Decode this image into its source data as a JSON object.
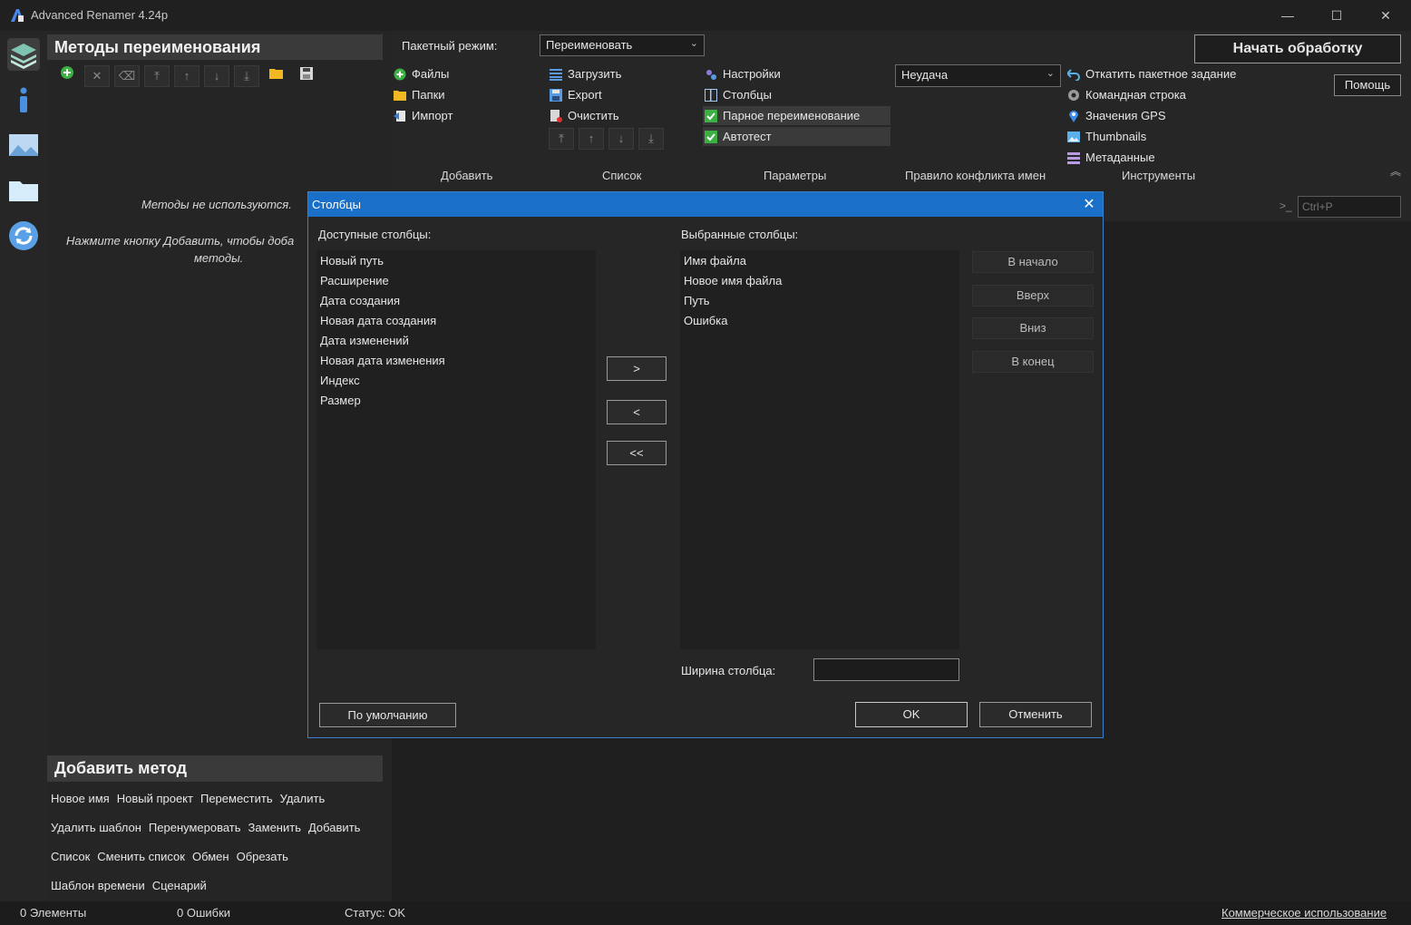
{
  "window": {
    "title": "Advanced Renamer 4.24p",
    "controls": [
      "—",
      "☐",
      "✕"
    ]
  },
  "left_nav": {
    "items": [
      "layers-icon",
      "info-icon",
      "image-icon",
      "folder-icon",
      "refresh-icon"
    ]
  },
  "methods_panel": {
    "title": "Методы переименования",
    "empty_text": "Методы не используются.",
    "hint_line1": "Нажмите кнопку Добавить, чтобы доба",
    "hint_line2": "методы.",
    "toolbar": [
      "+",
      "✕",
      "⌫",
      "⤒",
      "↑",
      "↓",
      "⤓",
      "📁",
      "💾"
    ]
  },
  "add_method": {
    "title": "Добавить метод",
    "rows": [
      [
        "Новое имя",
        "Новый проект",
        "Переместить",
        "Удалить"
      ],
      [
        "Удалить шаблон",
        "Перенумеровать",
        "Заменить",
        "Добавить"
      ],
      [
        "Список",
        "Сменить список",
        "Обмен",
        "Обрезать"
      ],
      [
        "Шаблон времени",
        "Сценарий"
      ]
    ]
  },
  "ribbon": {
    "batch_mode_label": "Пакетный режим:",
    "batch_mode_value": "Переименовать",
    "start_button": "Начать обработку",
    "help_button": "Помощь",
    "add_group": {
      "files": "Файлы",
      "folders": "Папки",
      "import": "Импорт",
      "tab": "Добавить"
    },
    "list_group": {
      "load": "Загрузить",
      "export": "Export",
      "clear": "Очистить",
      "tab": "Список"
    },
    "params_group": {
      "settings": "Настройки",
      "columns": "Столбцы",
      "pair_rename": "Парное переименование",
      "autotest": "Автотест",
      "tab": "Параметры"
    },
    "conflict_group": {
      "value": "Неудача",
      "tab": "Правило конфликта имен"
    },
    "tools_group": {
      "undo_batch": "Откатить пакетное задание",
      "command_line": "Командная строка",
      "gps": "Значения GPS",
      "thumbnails": "Thumbnails",
      "metadata": "Метаданные",
      "tab": "Инструменты"
    },
    "search_placeholder": "Ctrl+P"
  },
  "dialog": {
    "title": "Столбцы",
    "available_label": "Доступные столбцы:",
    "available": [
      "Новый путь",
      "Расширение",
      "Дата создания",
      "Новая дата создания",
      "Дата изменений",
      "Новая дата изменения",
      "Индекс",
      "Размер"
    ],
    "selected_label": "Выбранные столбцы:",
    "selected": [
      "Имя файла",
      "Новое имя файла",
      "Путь",
      "Ошибка"
    ],
    "move_add": ">",
    "move_remove": "<",
    "move_remove_all": "<<",
    "to_start": "В начало",
    "up": "Вверх",
    "down": "Вниз",
    "to_end": "В конец",
    "width_label": "Ширина столбца:",
    "width_value": "",
    "default_button": "По умолчанию",
    "ok_button": "OK",
    "cancel_button": "Отменить"
  },
  "status": {
    "items": "0 Элементы",
    "errors": "0 Ошибки",
    "status": "Статус: OK",
    "license": "Коммерческое использование"
  }
}
